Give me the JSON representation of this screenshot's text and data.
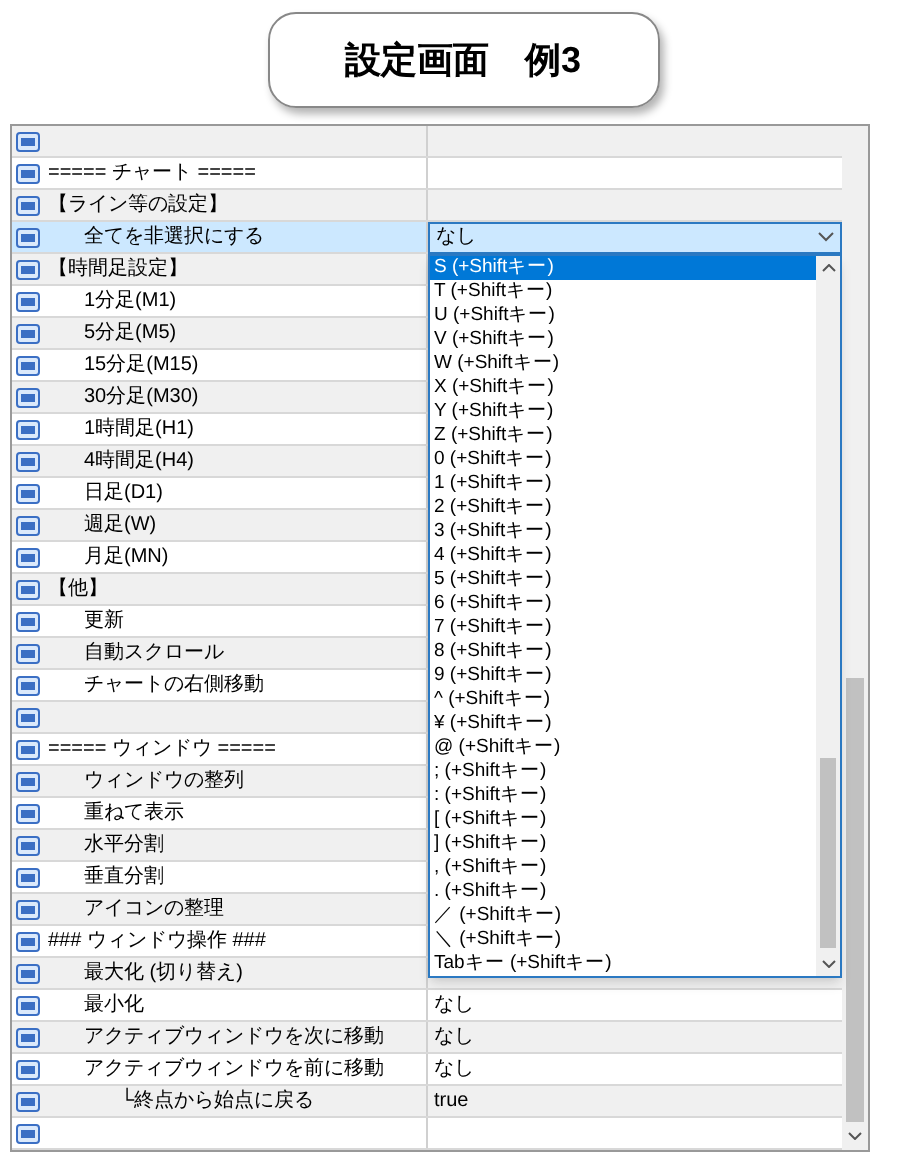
{
  "title": "設定画面　例3",
  "rows": [
    {
      "label": "",
      "selected": false
    },
    {
      "label": "===== チャート =====",
      "selected": false
    },
    {
      "label": "【ライン等の設定】",
      "selected": false,
      "children": [
        {
          "label": "全てを非選択にする",
          "selected": true,
          "dropdown": {
            "value": "なし",
            "expanded": true,
            "options": [
              {
                "label": "S (+Shiftキー)",
                "selected": true
              },
              {
                "label": "T (+Shiftキー)",
                "selected": false
              },
              {
                "label": "U (+Shiftキー)",
                "selected": false
              },
              {
                "label": "V (+Shiftキー)",
                "selected": false
              },
              {
                "label": "W (+Shiftキー)",
                "selected": false
              },
              {
                "label": "X (+Shiftキー)",
                "selected": false
              },
              {
                "label": "Y (+Shiftキー)",
                "selected": false
              },
              {
                "label": "Z (+Shiftキー)",
                "selected": false
              },
              {
                "label": "0 (+Shiftキー)",
                "selected": false
              },
              {
                "label": "1 (+Shiftキー)",
                "selected": false
              },
              {
                "label": "2 (+Shiftキー)",
                "selected": false
              },
              {
                "label": "3 (+Shiftキー)",
                "selected": false
              },
              {
                "label": "4 (+Shiftキー)",
                "selected": false
              },
              {
                "label": "5 (+Shiftキー)",
                "selected": false
              },
              {
                "label": "6 (+Shiftキー)",
                "selected": false
              },
              {
                "label": "7 (+Shiftキー)",
                "selected": false
              },
              {
                "label": "8 (+Shiftキー)",
                "selected": false
              },
              {
                "label": "9 (+Shiftキー)",
                "selected": false
              },
              {
                "label": "^ (+Shiftキー)",
                "selected": false
              },
              {
                "label": "¥ (+Shiftキー)",
                "selected": false
              },
              {
                "label": "@ (+Shiftキー)",
                "selected": false
              },
              {
                "label": "; (+Shiftキー)",
                "selected": false
              },
              {
                "label": ": (+Shiftキー)",
                "selected": false
              },
              {
                "label": "[ (+Shiftキー)",
                "selected": false
              },
              {
                "label": "] (+Shiftキー)",
                "selected": false
              },
              {
                "label": ", (+Shiftキー)",
                "selected": false
              },
              {
                "label": ". (+Shiftキー)",
                "selected": false
              },
              {
                "label": "／ (+Shiftキー)",
                "selected": false
              },
              {
                "label": "＼ (+Shiftキー)",
                "selected": false
              },
              {
                "label": "Tabキー (+Shiftキー)",
                "selected": false
              }
            ]
          }
        }
      ]
    },
    {
      "label": "【時間足設定】",
      "selected": false,
      "children": [
        {
          "label": "1分足(M1)",
          "selected": false
        },
        {
          "label": "5分足(M5)",
          "selected": false
        },
        {
          "label": "15分足(M15)",
          "selected": false
        },
        {
          "label": "30分足(M30)",
          "selected": false
        },
        {
          "label": "1時間足(H1)",
          "selected": false
        },
        {
          "label": "4時間足(H4)",
          "selected": false
        },
        {
          "label": "日足(D1)",
          "selected": false
        },
        {
          "label": "週足(W)",
          "selected": false
        },
        {
          "label": "月足(MN)",
          "selected": false
        }
      ]
    },
    {
      "label": "【他】",
      "selected": false,
      "children": [
        {
          "label": "更新",
          "selected": false
        },
        {
          "label": "自動スクロール",
          "selected": false
        },
        {
          "label": "チャートの右側移動",
          "selected": false
        }
      ]
    },
    {
      "label": "",
      "selected": false
    },
    {
      "label": "===== ウィンドウ =====",
      "selected": false,
      "children": [
        {
          "label": "ウィンドウの整列",
          "selected": false
        },
        {
          "label": "重ねて表示",
          "selected": false
        },
        {
          "label": "水平分割",
          "selected": false
        },
        {
          "label": "垂直分割",
          "selected": false
        },
        {
          "label": "アイコンの整理",
          "selected": false
        }
      ]
    },
    {
      "label": "### ウィンドウ操作 ###",
      "selected": false,
      "children": [
        {
          "label": "最大化 (切り替え)",
          "selected": false
        },
        {
          "label": "最小化",
          "selected": false,
          "value": "なし"
        },
        {
          "label": "アクティブウィンドウを次に移動",
          "selected": false,
          "value": "なし"
        },
        {
          "label": "アクティブウィンドウを前に移動",
          "selected": false,
          "value": "なし",
          "children": [
            {
              "label": "└終点から始点に戻る",
              "selected": false,
              "value": "true"
            }
          ]
        }
      ]
    },
    {
      "label": "",
      "selected": false
    }
  ]
}
